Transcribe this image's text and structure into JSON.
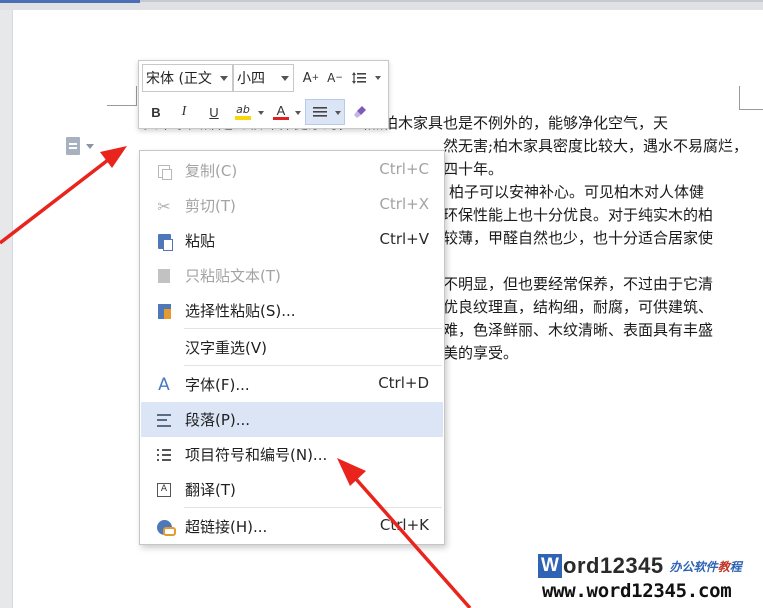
{
  "document": {
    "lines": [
      "实木家具都是比较环保健康的，当然柏木家具也是不例外的，能够净化空气，天",
      "然无害;柏木家具密度比较大，遇水不易腐烂，",
      "四十年。",
      "柏子可以安神补心。可见柏木对人体健",
      "环保性能上也十分优良。对于纯实木的柏",
      "较薄，甲醛自然也少，也十分适合居家使",
      "",
      "不明显，但也要经常保养，不过由于它清",
      "优良纹理直，结构细，耐腐，可供建筑、",
      "难，色泽鲜丽、木纹清晰、表面具有丰盛",
      "美的享受。"
    ]
  },
  "mini_toolbar": {
    "font_name": "宋体 (正文",
    "font_size": "小四",
    "grow_font_label": "A",
    "shrink_font_label": "A",
    "bold_label": "B",
    "italic_label": "I",
    "underline_label": "U",
    "highlight_label": "ab",
    "font_color_label": "A",
    "highlight_color": "#f5d90a",
    "font_color": "#e02020"
  },
  "context_menu": {
    "items": [
      {
        "label": "复制(C)",
        "shortcut": "Ctrl+C",
        "icon": "copy-icon",
        "enabled": false
      },
      {
        "label": "剪切(T)",
        "shortcut": "Ctrl+X",
        "icon": "cut-icon",
        "enabled": false
      },
      {
        "label": "粘贴",
        "shortcut": "Ctrl+V",
        "icon": "paste-icon",
        "enabled": true
      },
      {
        "label": "只粘贴文本(T)",
        "shortcut": "",
        "icon": "paste-text-icon",
        "enabled": false
      },
      {
        "label": "选择性粘贴(S)...",
        "shortcut": "",
        "icon": "paste-special-icon",
        "enabled": true
      },
      {
        "label": "汉字重选(V)",
        "shortcut": "",
        "icon": "",
        "enabled": true
      },
      {
        "label": "字体(F)...",
        "shortcut": "Ctrl+D",
        "icon": "font-icon",
        "enabled": true
      },
      {
        "label": "段落(P)...",
        "shortcut": "",
        "icon": "paragraph-icon",
        "enabled": true,
        "highlighted": true
      },
      {
        "label": "项目符号和编号(N)...",
        "shortcut": "",
        "icon": "bullet-list-icon",
        "enabled": true
      },
      {
        "label": "翻译(T)",
        "shortcut": "",
        "icon": "translate-icon",
        "enabled": true
      },
      {
        "label": "超链接(H)...",
        "shortcut": "Ctrl+K",
        "icon": "hyperlink-icon",
        "enabled": true
      }
    ],
    "highlight_color": "#dbe5f5"
  },
  "annotations": {
    "arrow_color": "#e8241c"
  },
  "watermark": {
    "brand_letter": "W",
    "brand_name": "ord12345",
    "tagline": "办公软件教程",
    "url": "www.word12345.com"
  }
}
